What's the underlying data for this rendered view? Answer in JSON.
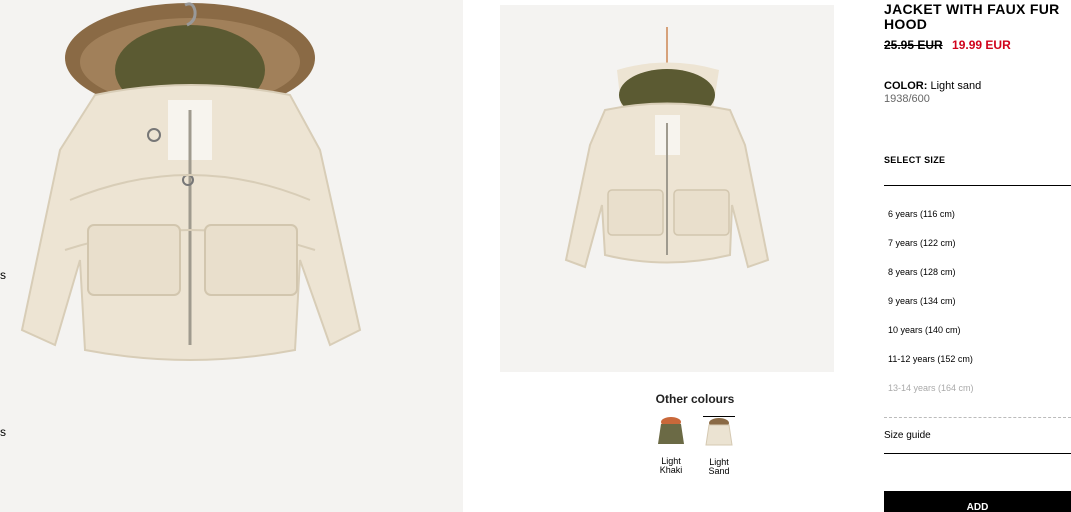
{
  "gallery": {
    "edge_texts": [
      "s",
      "s"
    ]
  },
  "other_colours": {
    "title": "Other colours",
    "swatches": [
      {
        "label": "Light\nKhaki",
        "color": "#6b6a45"
      },
      {
        "label": "Light\nSand",
        "color": "#ebe3d2",
        "selected": true
      }
    ]
  },
  "product": {
    "name": "JACKET WITH FAUX FUR HOOD",
    "old_price": "25.95 EUR",
    "new_price": "19.99 EUR",
    "color_label": "COLOR:",
    "color_value": "Light sand",
    "reference": "1938/600",
    "select_size": "SELECT SIZE",
    "sizes": [
      {
        "label": "6 years (116 cm)"
      },
      {
        "label": "7 years (122 cm)"
      },
      {
        "label": "8 years (128 cm)"
      },
      {
        "label": "9 years (134 cm)"
      },
      {
        "label": "10 years (140 cm)"
      },
      {
        "label": "11-12 years (152 cm)"
      },
      {
        "label": "13-14 years (164 cm)",
        "disabled": true
      }
    ],
    "size_guide": "Size guide",
    "add_button": "ADD"
  },
  "colors": {
    "sale_red": "#d0021b",
    "jacket_cream": "#ede4d3",
    "hood_lining": "#5b5a32",
    "fur": "#8a6a45",
    "background": "#f4f3f1"
  }
}
